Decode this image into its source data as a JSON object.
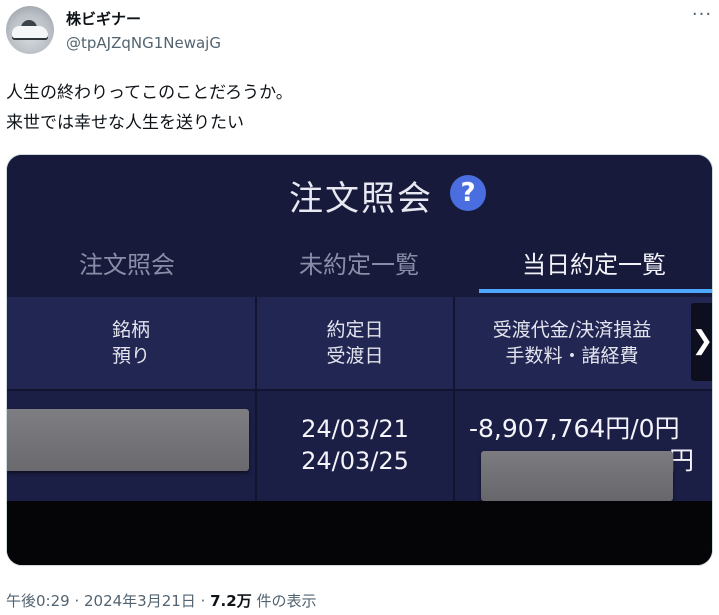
{
  "user": {
    "display_name": "株ビギナー",
    "handle": "@tpAJZqNG1NewajG",
    "avatar_icon": "car-avatar-icon"
  },
  "more_label": "···",
  "tweet": {
    "line1": "人生の終わりってこのことだろうか。",
    "line2": "来世では幸せな人生を送りたい"
  },
  "screenshot": {
    "title": "注文照会",
    "help_icon": "?",
    "tabs": [
      {
        "label": "注文照会",
        "active": false
      },
      {
        "label": "未約定一覧",
        "active": false
      },
      {
        "label": "当日約定一覧",
        "active": true
      }
    ],
    "columns": [
      {
        "line1": "銘柄",
        "line2": "預り"
      },
      {
        "line1": "約定日",
        "line2": "受渡日"
      },
      {
        "line1": "受渡代金/決済損益",
        "line2": "手数料・諸経費"
      }
    ],
    "scroll_arrow": "❯",
    "row": {
      "trade_date": "24/03/21",
      "settle_date": "24/03/25",
      "amount": "-8,907,764円/0円",
      "fee_suffix": "円"
    },
    "colors": {
      "accent": "#4da6ff",
      "background": "#171a3a",
      "help": "#4a6ee0"
    }
  },
  "meta": {
    "time": "午後0:29",
    "sep1": " · ",
    "date": "2024年3月21日",
    "sep2": " · ",
    "views": "7.2万",
    "views_label": " 件の表示"
  }
}
